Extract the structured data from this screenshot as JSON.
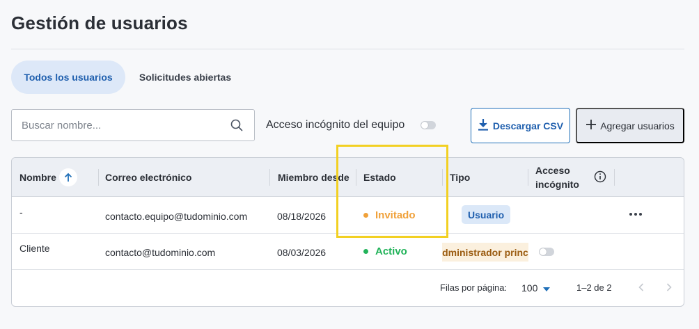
{
  "page": {
    "title": "Gestión de usuarios"
  },
  "tabs": [
    {
      "label": "Todos los usuarios",
      "active": true
    },
    {
      "label": "Solicitudes abiertas",
      "active": false
    }
  ],
  "toolbar": {
    "search_placeholder": "Buscar nombre...",
    "search_value": "",
    "incognito_label": "Acceso incógnito del equipo",
    "incognito_enabled": false,
    "download_label": "Descargar CSV",
    "add_label": "Agregar usuarios"
  },
  "table": {
    "columns": {
      "name": "Nombre",
      "email": "Correo electrónico",
      "member_since": "Miembro desde",
      "status": "Estado",
      "type": "Tipo",
      "incognito_line1": "Acceso",
      "incognito_line2": "incógnito"
    },
    "rows": [
      {
        "name": "-",
        "email": "contacto.equipo@tudominio.com",
        "member_since": "08/18/2026",
        "status": "Invitado",
        "type": "Usuario"
      },
      {
        "name": "Cliente",
        "email": "contacto@tudominio.com",
        "member_since": "08/03/2026",
        "status": "Activo",
        "type": "Administrador principal",
        "incognito_enabled": false
      }
    ],
    "pagination": {
      "rows_per_page_label": "Filas por página:",
      "rows_per_page": "100",
      "range": "1–2 de 2"
    }
  },
  "colors": {
    "accent": "#1f5fae",
    "status_invited": "#f0a13a",
    "status_active": "#22b35a",
    "highlight": "#f2d022"
  },
  "icons": [
    "search-icon",
    "download-icon",
    "plus-icon",
    "sort-ascending-icon",
    "info-icon",
    "more-horizontal-icon",
    "chevron-down-icon",
    "chevron-left-icon",
    "chevron-right-icon"
  ]
}
